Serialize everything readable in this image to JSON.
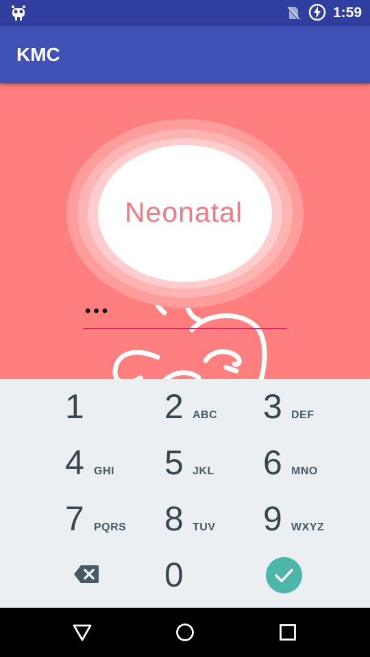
{
  "status_bar": {
    "time": "1:59",
    "icons": [
      "android-debug-icon",
      "no-sim-icon",
      "battery-charging-icon"
    ]
  },
  "app_bar": {
    "title": "KMC"
  },
  "content": {
    "logo_text": "Neonatal",
    "pin_masked": "•••",
    "background_color": "#FF7F7F",
    "underline_color": "#E91E63"
  },
  "keypad": {
    "keys": [
      {
        "digit": "1",
        "letters": ""
      },
      {
        "digit": "2",
        "letters": "ABC"
      },
      {
        "digit": "3",
        "letters": "DEF"
      },
      {
        "digit": "4",
        "letters": "GHI"
      },
      {
        "digit": "5",
        "letters": "JKL"
      },
      {
        "digit": "6",
        "letters": "MNO"
      },
      {
        "digit": "7",
        "letters": "PQRS"
      },
      {
        "digit": "8",
        "letters": "TUV"
      },
      {
        "digit": "9",
        "letters": "WXYZ"
      },
      {
        "digit": "0",
        "letters": ""
      }
    ],
    "backspace_icon": "backspace-icon",
    "confirm_icon": "check-icon",
    "confirm_color": "#4DB6AC"
  },
  "nav_bar": {
    "icons": [
      "back-icon",
      "home-icon",
      "recents-icon"
    ]
  },
  "colors": {
    "primary": "#3F51B5",
    "primary_dark": "#303F9F",
    "keypad_bg": "#ECEFF1"
  }
}
